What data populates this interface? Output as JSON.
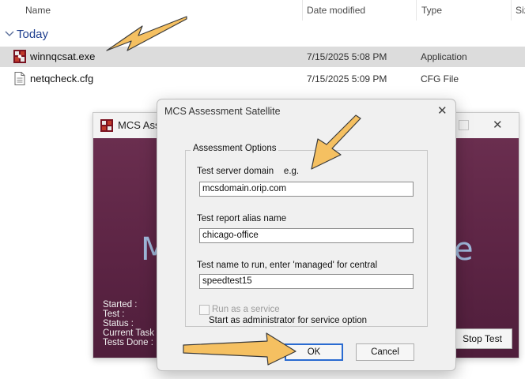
{
  "explorer": {
    "columns": {
      "name": "Name",
      "date_modified": "Date modified",
      "type": "Type",
      "size": "Siz"
    },
    "group": {
      "label": "Today",
      "icon": "chevron-down-icon"
    },
    "files": [
      {
        "name": "winnqcsat.exe",
        "date": "7/15/2025 5:08 PM",
        "type": "Application",
        "icon": "app-icon",
        "selected": true
      },
      {
        "name": "netqcheck.cfg",
        "date": "7/15/2025 5:09 PM",
        "type": "CFG File",
        "icon": "document-icon",
        "selected": false
      }
    ]
  },
  "background_window": {
    "title": "MCS Asse",
    "big_text_left": "M",
    "big_text_right": "e",
    "status_labels": [
      "Started :",
      "Test :",
      "Status :",
      "Current Task :",
      "Tests Done :"
    ],
    "stop_button": "Stop Test"
  },
  "dialog": {
    "title": "MCS Assessment Satellite",
    "close_glyph": "✕",
    "groupbox_label": "Assessment Options",
    "fields": [
      {
        "label": "Test server domain    e.g.",
        "value": "mcsdomain.orip.com"
      },
      {
        "label": "Test report alias name",
        "value": "chicago-office"
      },
      {
        "label": "Test name to run, enter 'managed' for central",
        "value": "speedtest15"
      }
    ],
    "checkbox_label": "Run as a service",
    "checkbox_checked": false,
    "hint": "Start as administrator for service option",
    "ok_button": "OK",
    "cancel_button": "Cancel"
  },
  "colors": {
    "arrow": "#f5c061",
    "arrow_stroke": "#3a3a3a",
    "selection": "#dcdcdc",
    "bg_window_body": "#5c2444"
  }
}
